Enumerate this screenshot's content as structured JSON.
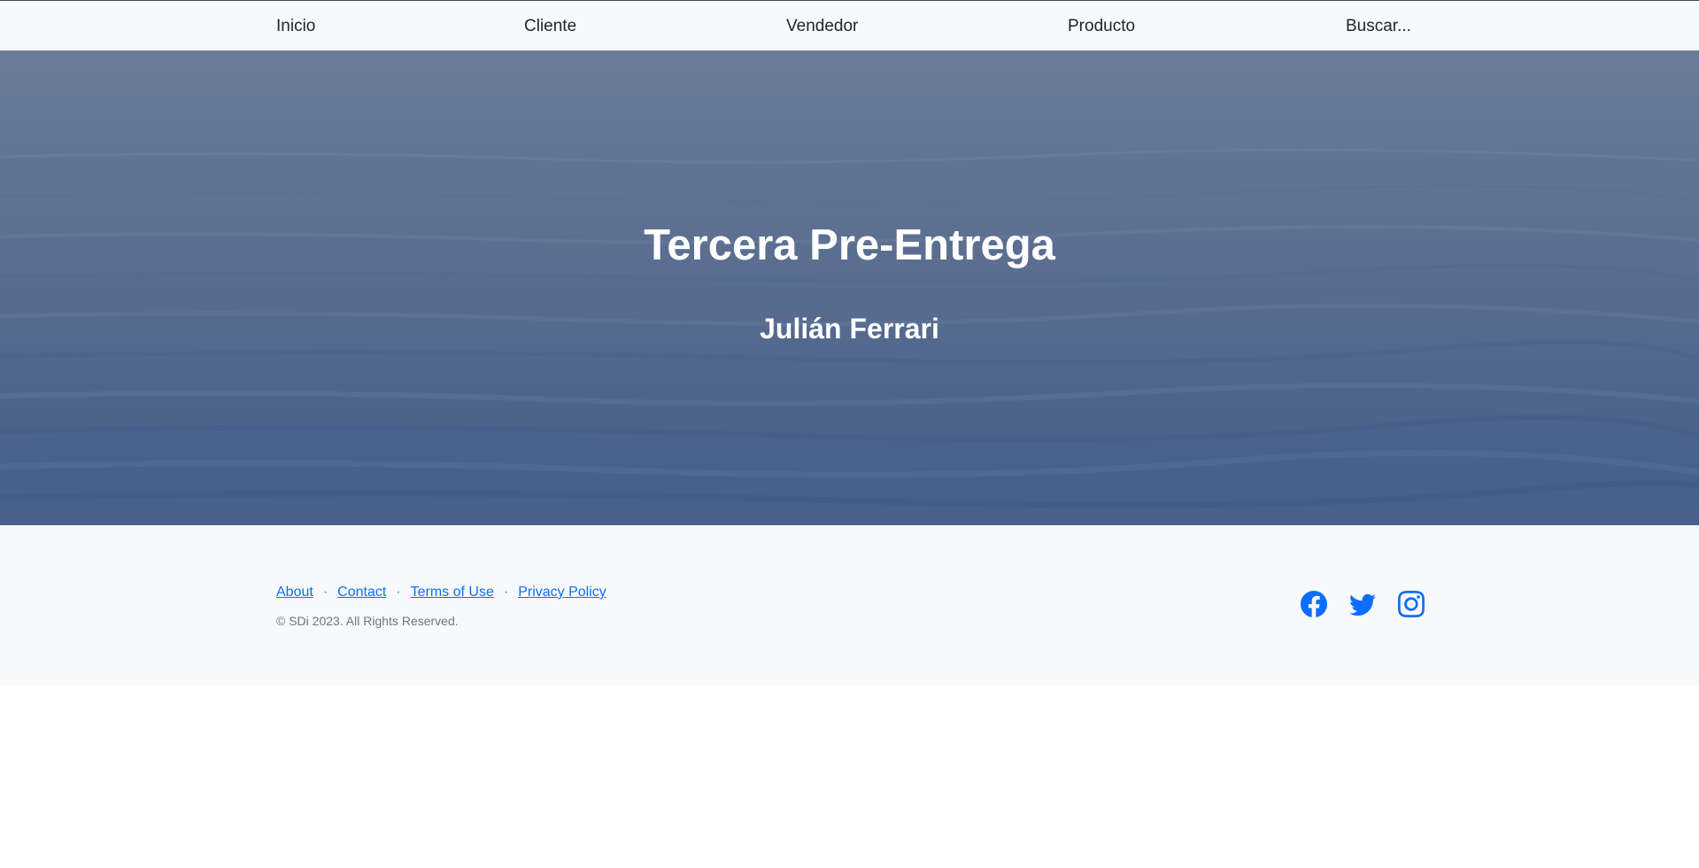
{
  "navbar": {
    "items": [
      {
        "label": "Inicio"
      },
      {
        "label": "Cliente"
      },
      {
        "label": "Vendedor"
      },
      {
        "label": "Producto"
      },
      {
        "label": "Buscar..."
      }
    ]
  },
  "hero": {
    "title": "Tercera Pre-Entrega",
    "subtitle": "Julián Ferrari"
  },
  "footer": {
    "links": [
      {
        "label": "About"
      },
      {
        "label": "Contact"
      },
      {
        "label": "Terms of Use"
      },
      {
        "label": "Privacy Policy"
      }
    ],
    "separator": "·",
    "copyright": "© SDi 2023. All Rights Reserved.",
    "social_icons": [
      "facebook-icon",
      "twitter-icon",
      "instagram-icon"
    ],
    "link_color": "#0d6efd",
    "icon_color": "#0d6efd"
  },
  "colors": {
    "navbar_bg": "#f8f9fa",
    "footer_bg": "#f8f9fa",
    "hero_text": "#ffffff"
  }
}
